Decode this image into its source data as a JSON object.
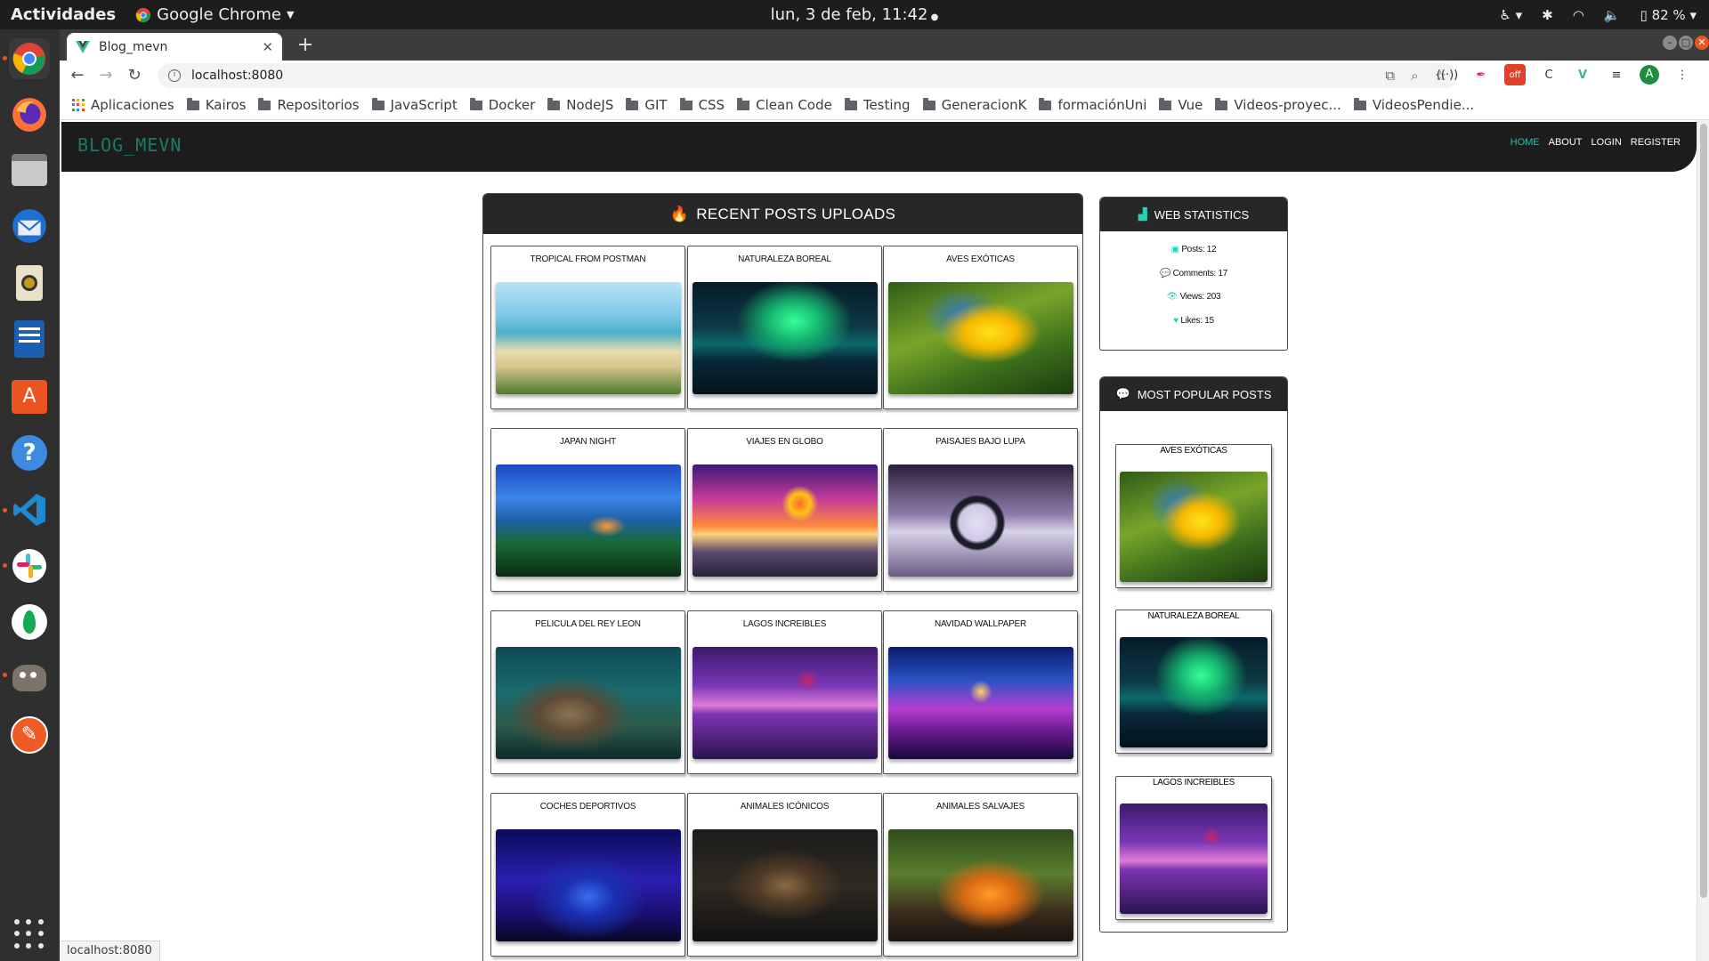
{
  "topbar": {
    "activities": "Actividades",
    "app_name": "Google Chrome",
    "clock": "lun,  3 de feb, 11:42",
    "battery": "82 %"
  },
  "dock": {
    "items": [
      "chrome-icon",
      "firefox-icon",
      "files-icon",
      "thunderbird-icon",
      "rhythmbox-icon",
      "writer-icon",
      "software-icon",
      "help-icon",
      "vscode-icon",
      "slack-icon",
      "mongodb-compass-icon",
      "gimp-icon",
      "postman-icon"
    ]
  },
  "browser": {
    "tab_title": "Blog_mevn",
    "url": "localhost:8080",
    "bookmarks": [
      "Aplicaciones",
      "Kairos",
      "Repositorios",
      "JavaScript",
      "Docker",
      "NodeJS",
      "GIT",
      "CSS",
      "Clean Code",
      "Testing",
      "GeneracionK",
      "formaciónUni",
      "Vue",
      "Videos-proyec...",
      "VideosPendie..."
    ],
    "status_url": "localhost:8080",
    "colors": {
      "tab_strip": "#3c3c3c",
      "accent_green": "#1e8e3e"
    }
  },
  "site": {
    "brand": "BLOG_MEVN",
    "nav": [
      "HOME",
      "ABOUT",
      "LOGIN",
      "REGISTER"
    ],
    "recent_title": "RECENT POSTS UPLOADS",
    "posts": [
      {
        "title": "TROPICAL FROM POSTMAN",
        "scene": "tropical"
      },
      {
        "title": "NATURALEZA BOREAL",
        "scene": "aurora"
      },
      {
        "title": "AVES EXÓTICAS",
        "scene": "parrot"
      },
      {
        "title": "JAPAN NIGHT",
        "scene": "japan"
      },
      {
        "title": "VIAJES EN GLOBO",
        "scene": "balloon"
      },
      {
        "title": "PAISAJES BAJO LUPA",
        "scene": "lupa"
      },
      {
        "title": "PELICULA DEL REY LEON",
        "scene": "lion"
      },
      {
        "title": "LAGOS INCREIBLES",
        "scene": "lake"
      },
      {
        "title": "NAVIDAD WALLPAPER",
        "scene": "xmas"
      },
      {
        "title": "COCHES DEPORTIVOS",
        "scene": "car"
      },
      {
        "title": "ANIMALES ICÓNICOS",
        "scene": "eagle"
      },
      {
        "title": "ANIMALES SALVAJES",
        "scene": "tiger"
      }
    ],
    "stats": {
      "title": "WEB STATISTICS",
      "items": [
        {
          "label": "Posts: 12",
          "icon": "images-icon"
        },
        {
          "label": "Comments: 17",
          "icon": "comments-icon"
        },
        {
          "label": "Views: 203",
          "icon": "eye-icon"
        },
        {
          "label": "Likes: 15",
          "icon": "heart-icon"
        }
      ]
    },
    "popular": {
      "title": "MOST POPULAR POSTS",
      "items": [
        {
          "title": "AVES EXÓTICAS",
          "scene": "parrot"
        },
        {
          "title": "NATURALEZA BOREAL",
          "scene": "aurora"
        },
        {
          "title": "LAGOS INCREIBLES",
          "scene": "lake"
        }
      ]
    },
    "colors": {
      "accent": "#2ad0b2",
      "nav_active": "#22c0a8",
      "brand": "#1b7a67",
      "header_bg": "#272727"
    }
  }
}
